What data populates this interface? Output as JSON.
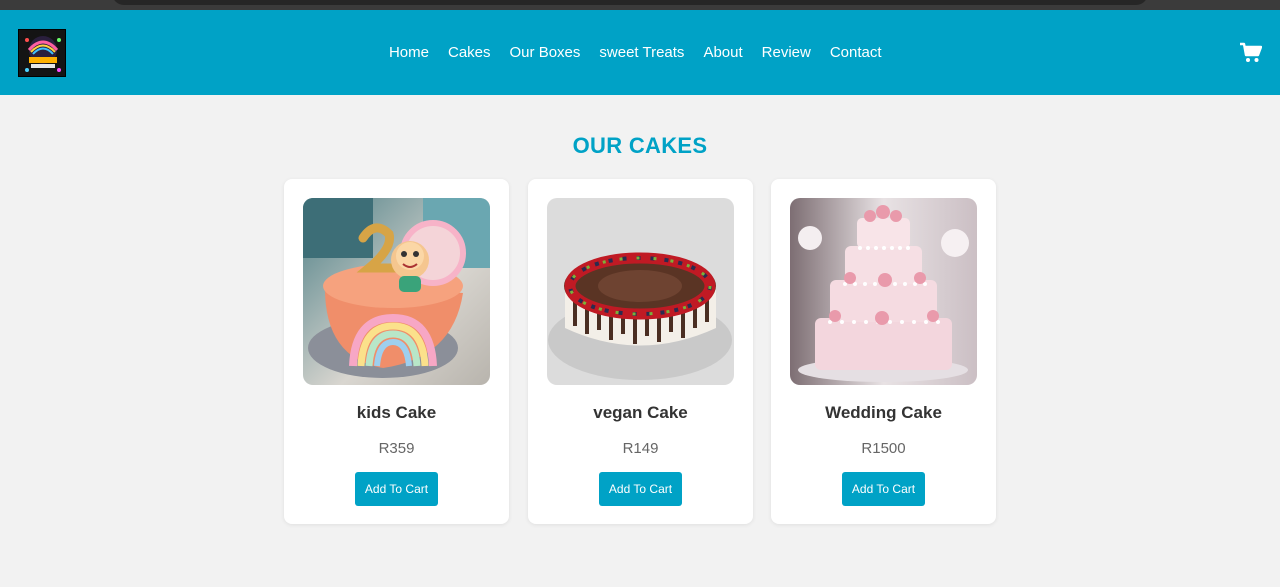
{
  "nav": {
    "items": [
      {
        "label": "Home"
      },
      {
        "label": "Cakes"
      },
      {
        "label": "Our Boxes"
      },
      {
        "label": "sweet Treats"
      },
      {
        "label": "About"
      },
      {
        "label": "Review"
      },
      {
        "label": "Contact"
      }
    ],
    "cart_icon": "shopping-cart-icon"
  },
  "section": {
    "title": "OUR CAKES"
  },
  "products": [
    {
      "name": "kids Cake",
      "price": "R359",
      "button": "Add To Cart"
    },
    {
      "name": "vegan Cake",
      "price": "R149",
      "button": "Add To Cart"
    },
    {
      "name": "Wedding Cake",
      "price": "R1500",
      "button": "Add To Cart"
    }
  ],
  "colors": {
    "brand": "#00a2c6",
    "background": "#f2f2f2",
    "card": "#ffffff"
  }
}
